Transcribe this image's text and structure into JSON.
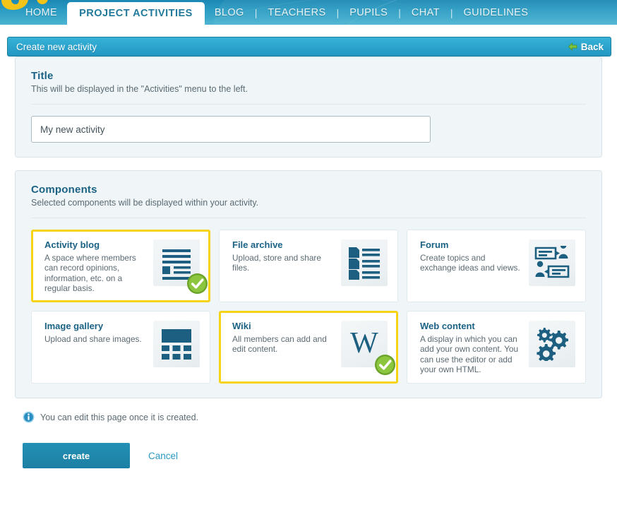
{
  "nav": {
    "logo_icon": "site-logo-mark",
    "items": [
      {
        "label": "HOME",
        "active": false
      },
      {
        "label": "PROJECT ACTIVITIES",
        "active": true
      },
      {
        "label": "BLOG",
        "active": false
      },
      {
        "label": "TEACHERS",
        "active": false
      },
      {
        "label": "PUPILS",
        "active": false
      },
      {
        "label": "CHAT",
        "active": false
      },
      {
        "label": "GUIDELINES",
        "active": false
      }
    ],
    "separator": "|"
  },
  "subheader": {
    "title": "Create new activity",
    "back_label": "Back",
    "back_icon": "arrow-left-icon"
  },
  "title_section": {
    "heading": "Title",
    "description": "This will be displayed in the \"Activities\" menu to the left.",
    "input_value": "My new activity",
    "input_placeholder": "My new activity"
  },
  "components_section": {
    "heading": "Components",
    "description": "Selected components will be displayed within your activity.",
    "cards": [
      {
        "title": "Activity blog",
        "description": "A space where members can record opinions, information, etc. on a regular basis.",
        "icon": "blog-document-icon",
        "selected": true
      },
      {
        "title": "File archive",
        "description": "Upload, store and share files.",
        "icon": "file-list-icon",
        "selected": false
      },
      {
        "title": "Forum",
        "description": "Create topics and exchange ideas and views.",
        "icon": "forum-discussion-icon",
        "selected": false
      },
      {
        "title": "Image gallery",
        "description": "Upload and share images.",
        "icon": "image-gallery-icon",
        "selected": false
      },
      {
        "title": "Wiki",
        "description": "All members can add and edit content.",
        "icon": "wiki-w-icon",
        "selected": true
      },
      {
        "title": "Web content",
        "description": "A display in which you can add your own content. You can use the editor or add your own HTML.",
        "icon": "gears-icon",
        "selected": false
      }
    ],
    "selected_badge_icon": "green-check-badge-icon"
  },
  "footer": {
    "info_icon": "info-circle-icon",
    "note": "You can edit this page once it is created.",
    "create_label": "create",
    "cancel_label": "Cancel"
  },
  "colors": {
    "header_blue": "#2d9ec4",
    "subheader_blue": "#2ba3cc",
    "selected_yellow": "#f5d316",
    "check_green": "#7cb82f",
    "heading_blue": "#1b6285",
    "button_blue": "#1c7fa3",
    "link_blue": "#2a9ac4",
    "logo_gold": "#f2c318"
  }
}
